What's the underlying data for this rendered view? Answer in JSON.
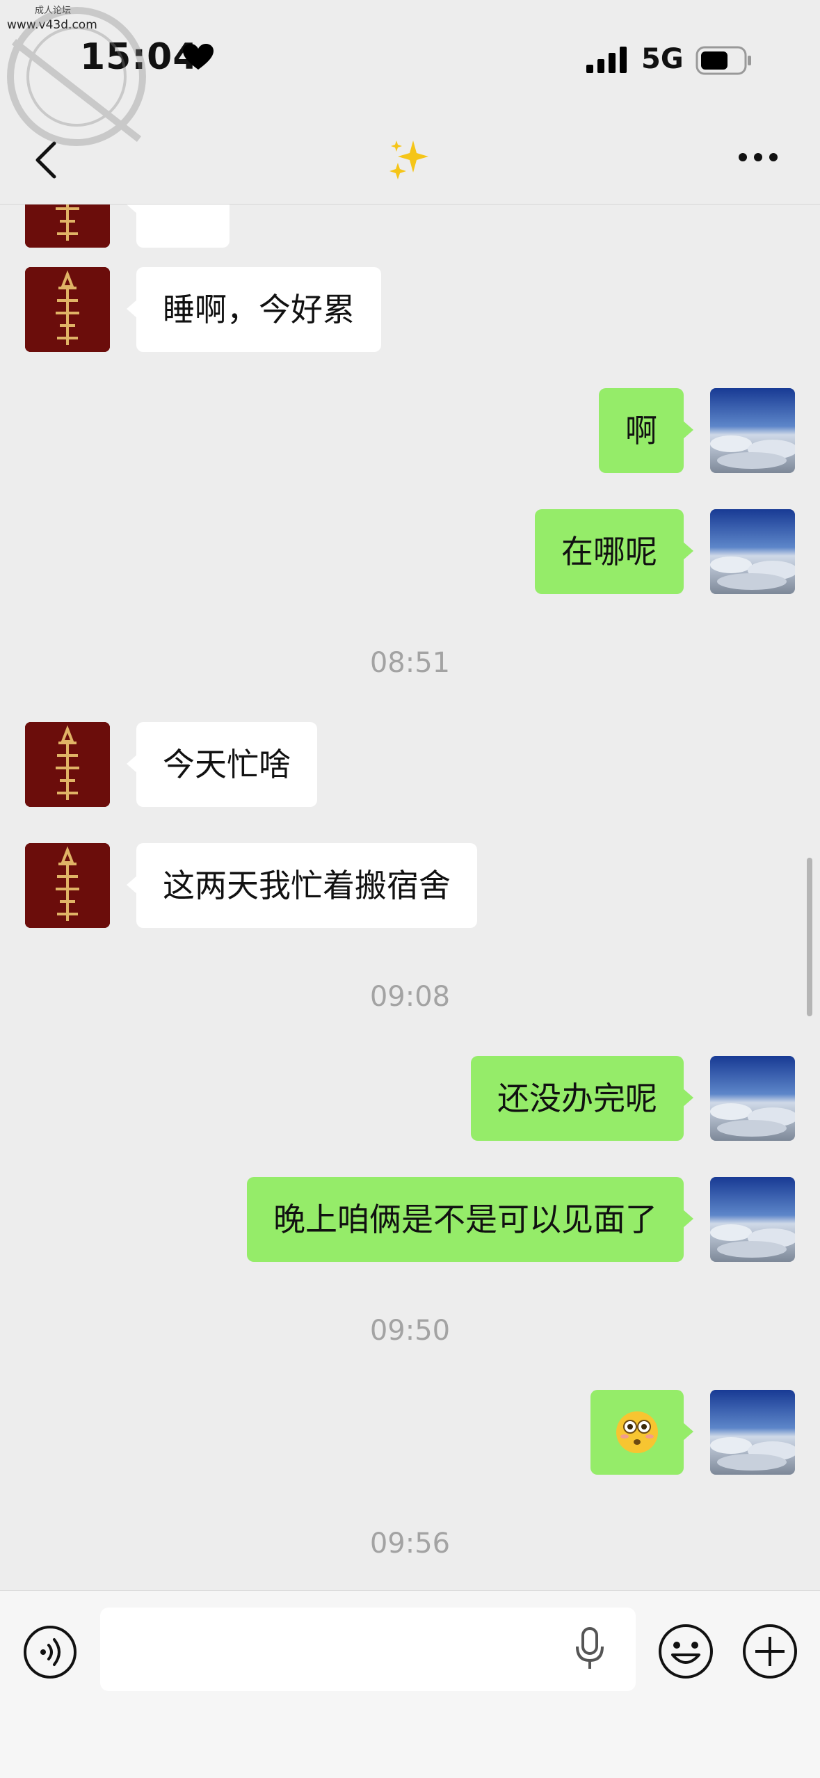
{
  "watermark": {
    "top_text": "成人论坛",
    "url": "www.v43d.com"
  },
  "status_bar": {
    "time": "15:04",
    "network": "5G"
  },
  "nav": {
    "title": "✨"
  },
  "colors": {
    "outgoing_bubble": "#95ec69",
    "incoming_bubble": "#ffffff",
    "background": "#ededed",
    "timestamp": "#a3a3a3"
  },
  "messages": [
    {
      "type": "in",
      "text": ""
    },
    {
      "type": "in",
      "text": "睡啊，今好累"
    },
    {
      "type": "out",
      "text": "啊"
    },
    {
      "type": "out",
      "text": "在哪呢"
    },
    {
      "type": "time",
      "text": "08:51"
    },
    {
      "type": "in",
      "text": "今天忙啥"
    },
    {
      "type": "in",
      "text": "这两天我忙着搬宿舍"
    },
    {
      "type": "time",
      "text": "09:08"
    },
    {
      "type": "out",
      "text": "还没办完呢"
    },
    {
      "type": "out",
      "text": "晚上咱俩是不是可以见面了"
    },
    {
      "type": "time",
      "text": "09:50"
    },
    {
      "type": "out",
      "text": "😳"
    },
    {
      "type": "time",
      "text": "09:56"
    }
  ],
  "input": {
    "value": "",
    "placeholder": ""
  },
  "icons": {
    "back": "back-chevron-icon",
    "more": "more-dots-icon",
    "voice": "voice-icon",
    "mic": "microphone-icon",
    "emoji": "emoji-icon",
    "plus": "plus-icon"
  }
}
